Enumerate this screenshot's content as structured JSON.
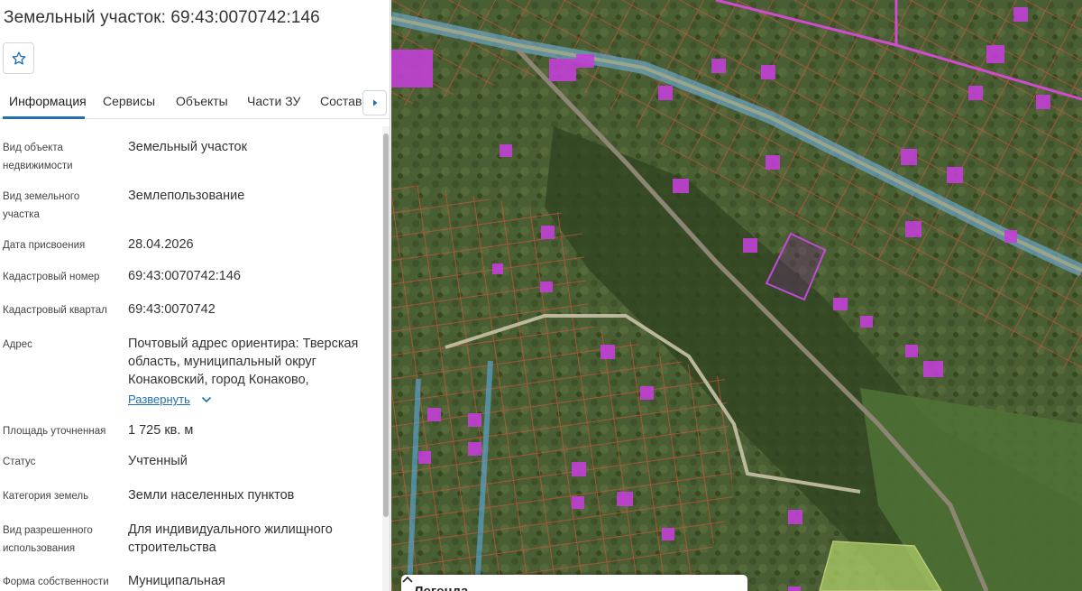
{
  "parcel": {
    "title": "Земельный участок: 69:43:0070742:146"
  },
  "tabs": [
    {
      "label": "Информация"
    },
    {
      "label": "Сервисы"
    },
    {
      "label": "Объекты"
    },
    {
      "label": "Части ЗУ"
    },
    {
      "label": "Состав"
    }
  ],
  "fields": [
    {
      "label": "Вид объекта недвижимости",
      "value": "Земельный участок"
    },
    {
      "label": "Вид земельного участка",
      "value": "Землепользование"
    },
    {
      "label": "Дата присвоения",
      "value": "28.04.2026"
    },
    {
      "label": "Кадастровый номер",
      "value": "69:43:0070742:146"
    },
    {
      "label": "Кадастровый квартал",
      "value": "69:43:0070742"
    },
    {
      "label": "Адрес",
      "value": "Почтовый адрес ориентира: Тверская область, муниципальный округ Конаковский, город Конаково,",
      "action": "Развернуть"
    },
    {
      "label": "Площадь уточненная",
      "value": "1 725 кв. м"
    },
    {
      "label": "Статус",
      "value": "Учтенный"
    },
    {
      "label": "Категория земель",
      "value": "Земли населенных пунктов"
    },
    {
      "label": "Вид разрешенного использования",
      "value": "Для индивидуального жилищного строительства"
    },
    {
      "label": "Форма собственности",
      "value": "Муниципальная"
    }
  ],
  "legend": {
    "title": "Легенда"
  },
  "icons": {
    "favorite": "star-outline-icon",
    "tab_scroll": "chevron-right-icon",
    "expand": "chevron-down-icon",
    "legend_toggle": "chevron-up-icon"
  },
  "colors": {
    "accent": "#1f6fb2",
    "parcel_outline": "#d9534f",
    "selected_parcel": "#b23cc8",
    "building": "#c23fd6",
    "road_highlight": "#5aa6d6"
  }
}
